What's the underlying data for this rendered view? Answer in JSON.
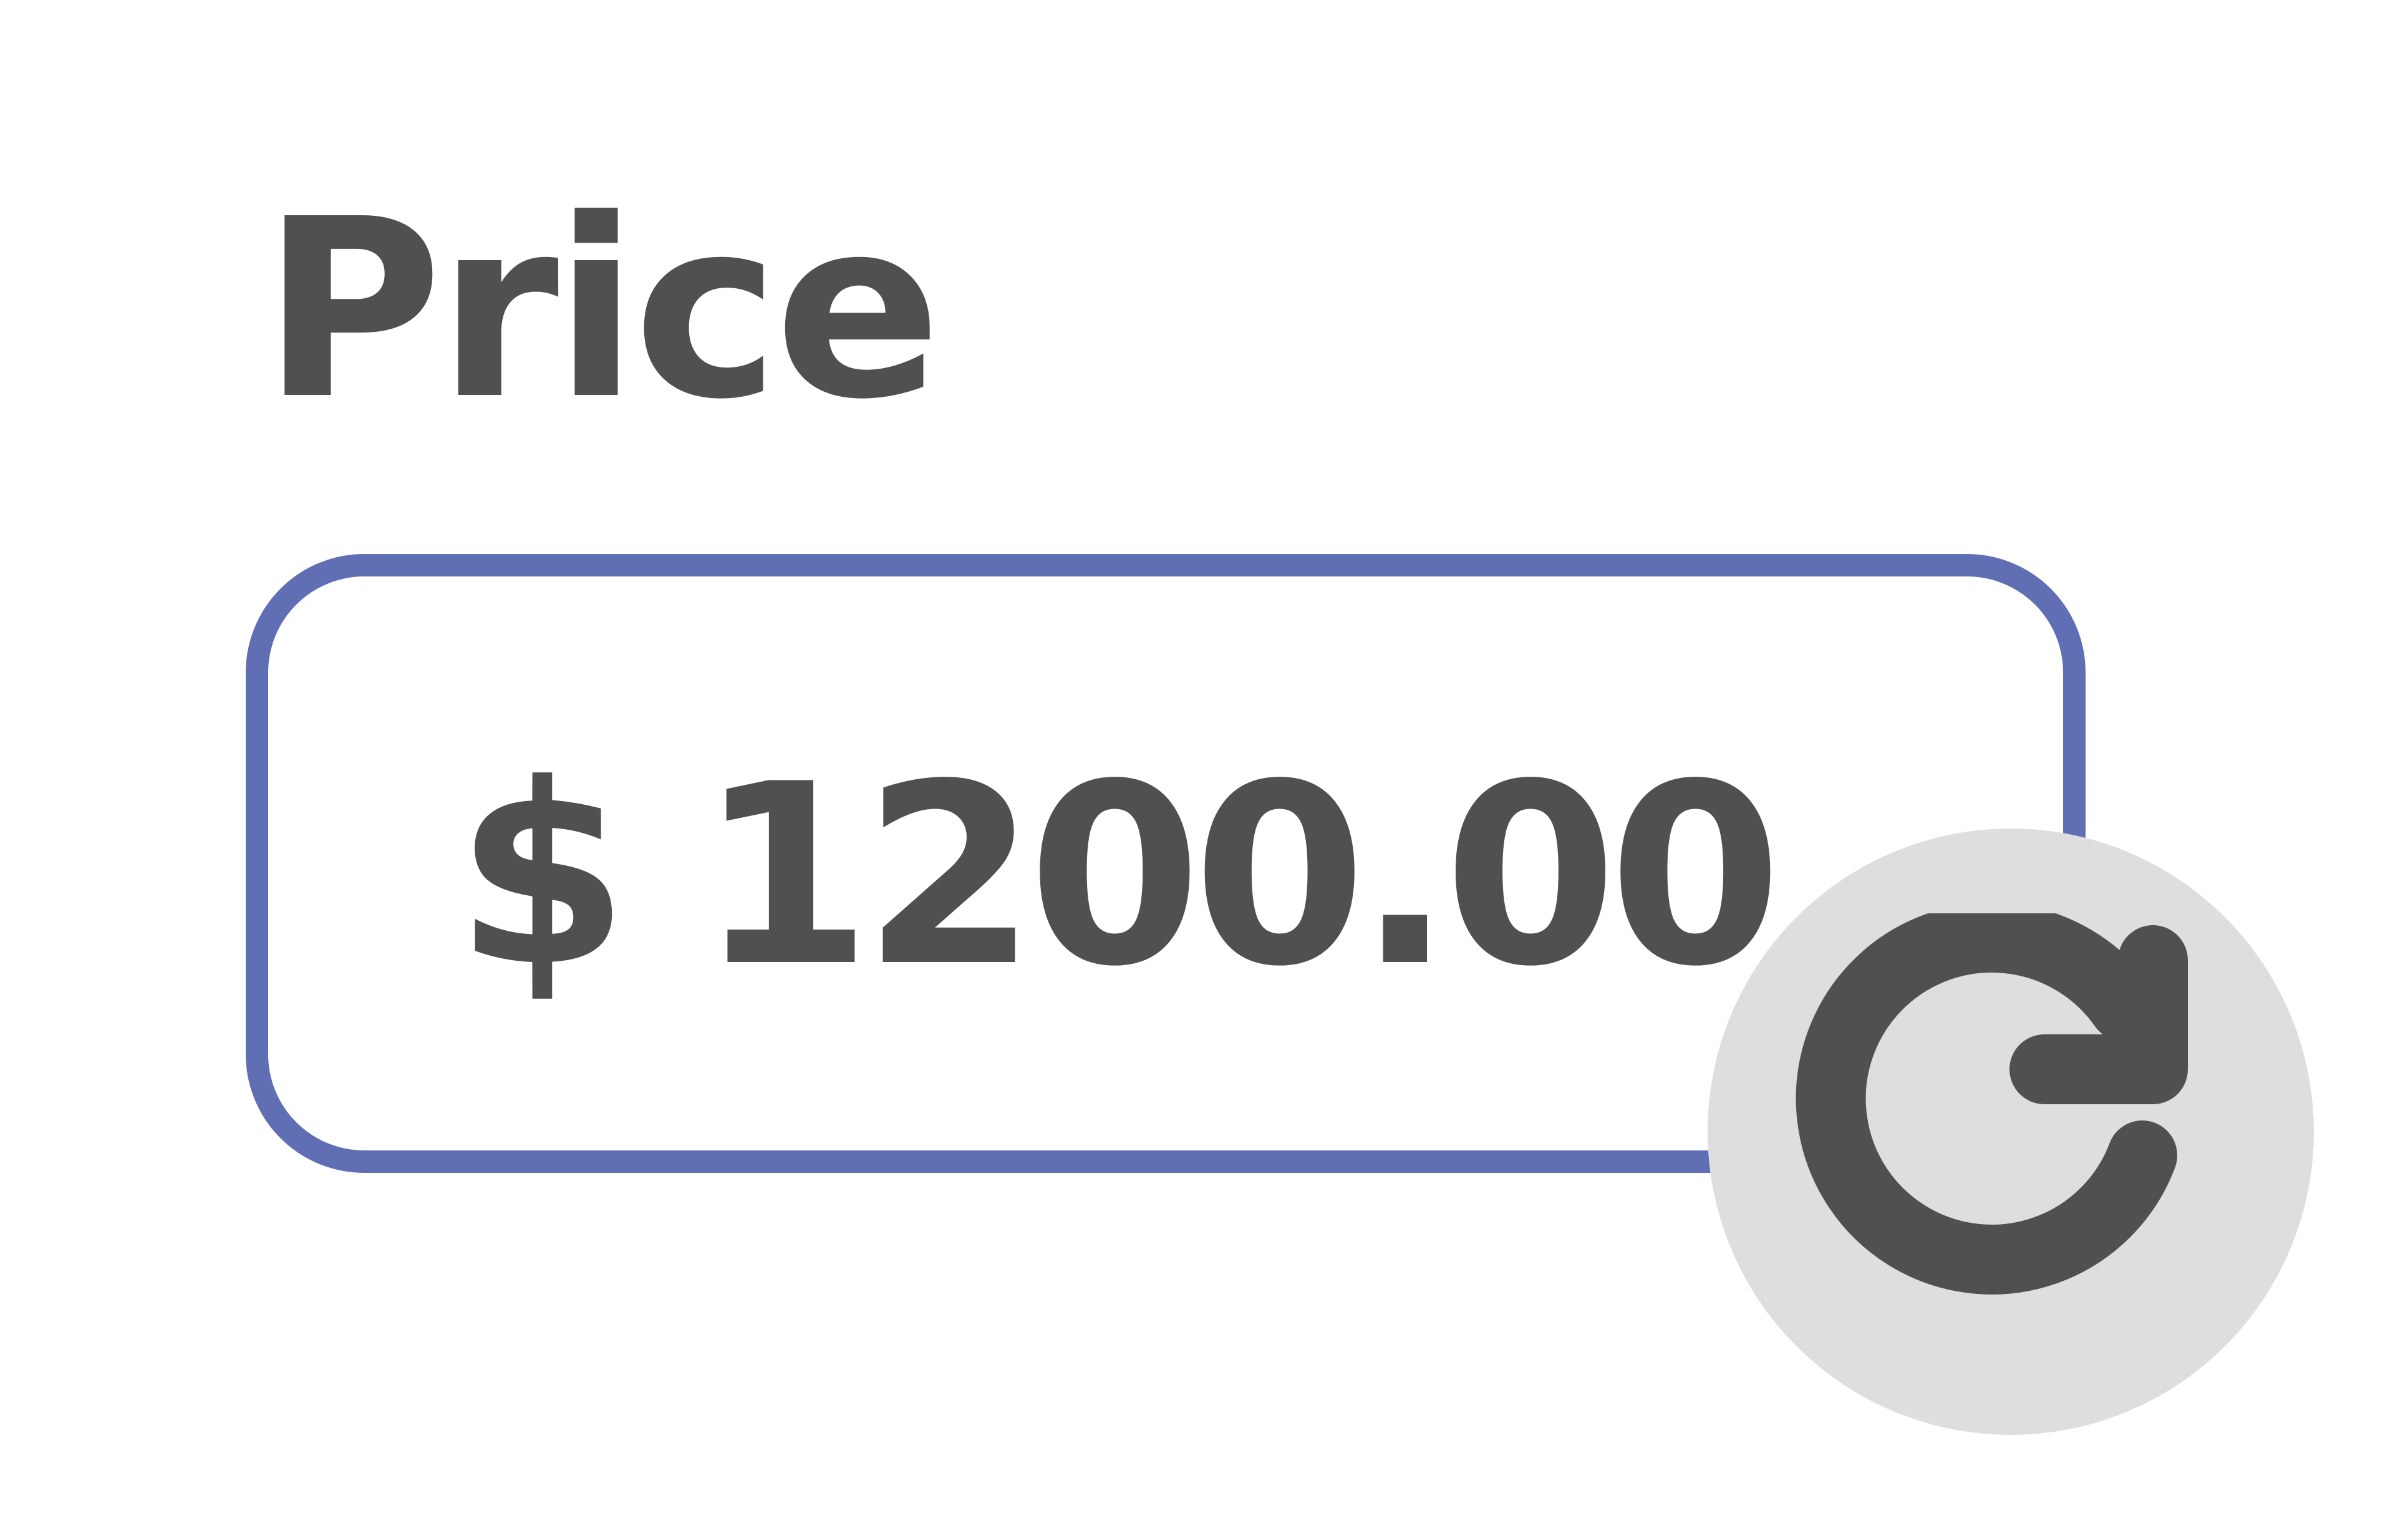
{
  "label": {
    "text": "Price"
  },
  "price_field": {
    "value": "$ 1200.00",
    "accent_color": "#606fb4"
  },
  "reset_button": {
    "icon": "rotate-clockwise-icon",
    "background_color": "#dedede",
    "icon_color": "#505050"
  }
}
